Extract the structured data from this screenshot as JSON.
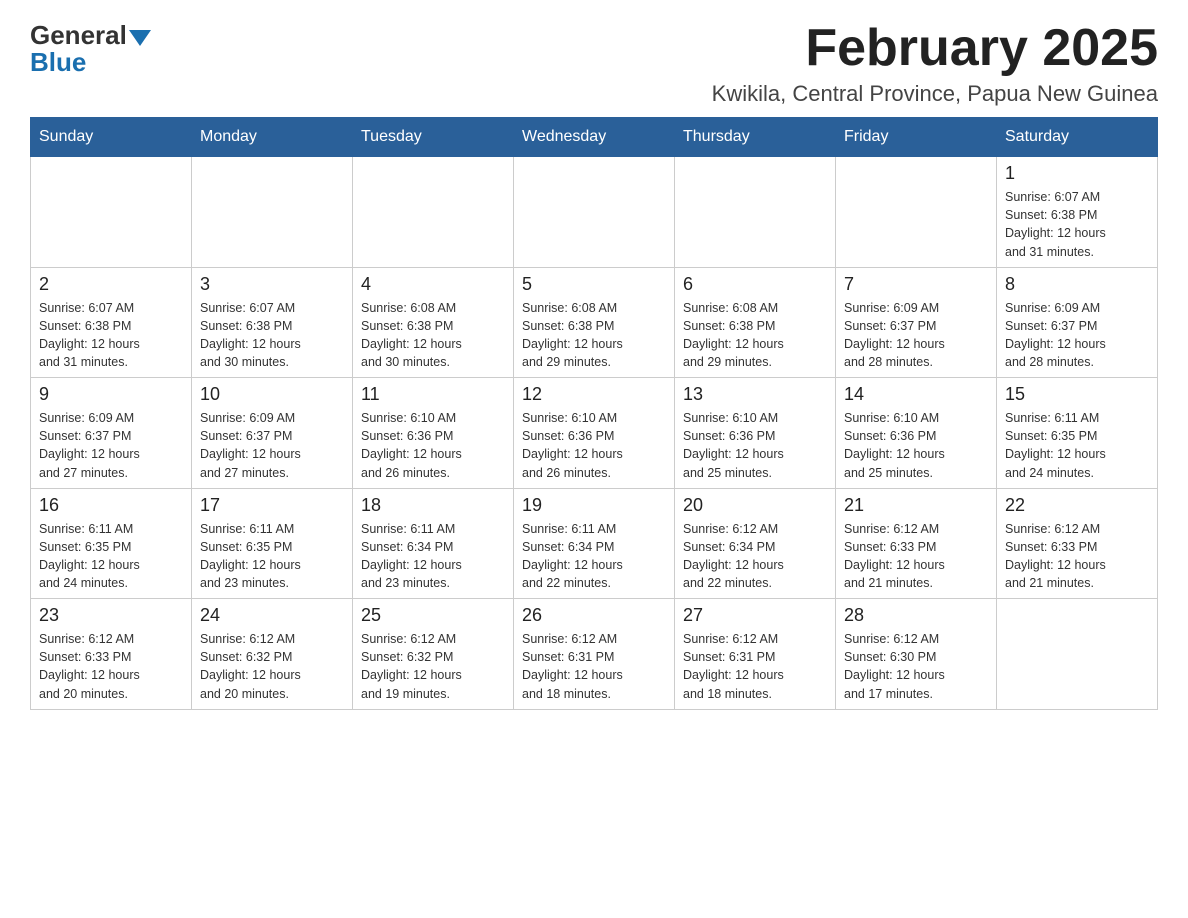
{
  "header": {
    "logo_general": "General",
    "logo_blue": "Blue",
    "month_title": "February 2025",
    "location": "Kwikila, Central Province, Papua New Guinea"
  },
  "weekdays": [
    "Sunday",
    "Monday",
    "Tuesday",
    "Wednesday",
    "Thursday",
    "Friday",
    "Saturday"
  ],
  "weeks": [
    [
      {
        "day": "",
        "info": ""
      },
      {
        "day": "",
        "info": ""
      },
      {
        "day": "",
        "info": ""
      },
      {
        "day": "",
        "info": ""
      },
      {
        "day": "",
        "info": ""
      },
      {
        "day": "",
        "info": ""
      },
      {
        "day": "1",
        "info": "Sunrise: 6:07 AM\nSunset: 6:38 PM\nDaylight: 12 hours\nand 31 minutes."
      }
    ],
    [
      {
        "day": "2",
        "info": "Sunrise: 6:07 AM\nSunset: 6:38 PM\nDaylight: 12 hours\nand 31 minutes."
      },
      {
        "day": "3",
        "info": "Sunrise: 6:07 AM\nSunset: 6:38 PM\nDaylight: 12 hours\nand 30 minutes."
      },
      {
        "day": "4",
        "info": "Sunrise: 6:08 AM\nSunset: 6:38 PM\nDaylight: 12 hours\nand 30 minutes."
      },
      {
        "day": "5",
        "info": "Sunrise: 6:08 AM\nSunset: 6:38 PM\nDaylight: 12 hours\nand 29 minutes."
      },
      {
        "day": "6",
        "info": "Sunrise: 6:08 AM\nSunset: 6:38 PM\nDaylight: 12 hours\nand 29 minutes."
      },
      {
        "day": "7",
        "info": "Sunrise: 6:09 AM\nSunset: 6:37 PM\nDaylight: 12 hours\nand 28 minutes."
      },
      {
        "day": "8",
        "info": "Sunrise: 6:09 AM\nSunset: 6:37 PM\nDaylight: 12 hours\nand 28 minutes."
      }
    ],
    [
      {
        "day": "9",
        "info": "Sunrise: 6:09 AM\nSunset: 6:37 PM\nDaylight: 12 hours\nand 27 minutes."
      },
      {
        "day": "10",
        "info": "Sunrise: 6:09 AM\nSunset: 6:37 PM\nDaylight: 12 hours\nand 27 minutes."
      },
      {
        "day": "11",
        "info": "Sunrise: 6:10 AM\nSunset: 6:36 PM\nDaylight: 12 hours\nand 26 minutes."
      },
      {
        "day": "12",
        "info": "Sunrise: 6:10 AM\nSunset: 6:36 PM\nDaylight: 12 hours\nand 26 minutes."
      },
      {
        "day": "13",
        "info": "Sunrise: 6:10 AM\nSunset: 6:36 PM\nDaylight: 12 hours\nand 25 minutes."
      },
      {
        "day": "14",
        "info": "Sunrise: 6:10 AM\nSunset: 6:36 PM\nDaylight: 12 hours\nand 25 minutes."
      },
      {
        "day": "15",
        "info": "Sunrise: 6:11 AM\nSunset: 6:35 PM\nDaylight: 12 hours\nand 24 minutes."
      }
    ],
    [
      {
        "day": "16",
        "info": "Sunrise: 6:11 AM\nSunset: 6:35 PM\nDaylight: 12 hours\nand 24 minutes."
      },
      {
        "day": "17",
        "info": "Sunrise: 6:11 AM\nSunset: 6:35 PM\nDaylight: 12 hours\nand 23 minutes."
      },
      {
        "day": "18",
        "info": "Sunrise: 6:11 AM\nSunset: 6:34 PM\nDaylight: 12 hours\nand 23 minutes."
      },
      {
        "day": "19",
        "info": "Sunrise: 6:11 AM\nSunset: 6:34 PM\nDaylight: 12 hours\nand 22 minutes."
      },
      {
        "day": "20",
        "info": "Sunrise: 6:12 AM\nSunset: 6:34 PM\nDaylight: 12 hours\nand 22 minutes."
      },
      {
        "day": "21",
        "info": "Sunrise: 6:12 AM\nSunset: 6:33 PM\nDaylight: 12 hours\nand 21 minutes."
      },
      {
        "day": "22",
        "info": "Sunrise: 6:12 AM\nSunset: 6:33 PM\nDaylight: 12 hours\nand 21 minutes."
      }
    ],
    [
      {
        "day": "23",
        "info": "Sunrise: 6:12 AM\nSunset: 6:33 PM\nDaylight: 12 hours\nand 20 minutes."
      },
      {
        "day": "24",
        "info": "Sunrise: 6:12 AM\nSunset: 6:32 PM\nDaylight: 12 hours\nand 20 minutes."
      },
      {
        "day": "25",
        "info": "Sunrise: 6:12 AM\nSunset: 6:32 PM\nDaylight: 12 hours\nand 19 minutes."
      },
      {
        "day": "26",
        "info": "Sunrise: 6:12 AM\nSunset: 6:31 PM\nDaylight: 12 hours\nand 18 minutes."
      },
      {
        "day": "27",
        "info": "Sunrise: 6:12 AM\nSunset: 6:31 PM\nDaylight: 12 hours\nand 18 minutes."
      },
      {
        "day": "28",
        "info": "Sunrise: 6:12 AM\nSunset: 6:30 PM\nDaylight: 12 hours\nand 17 minutes."
      },
      {
        "day": "",
        "info": ""
      }
    ]
  ]
}
